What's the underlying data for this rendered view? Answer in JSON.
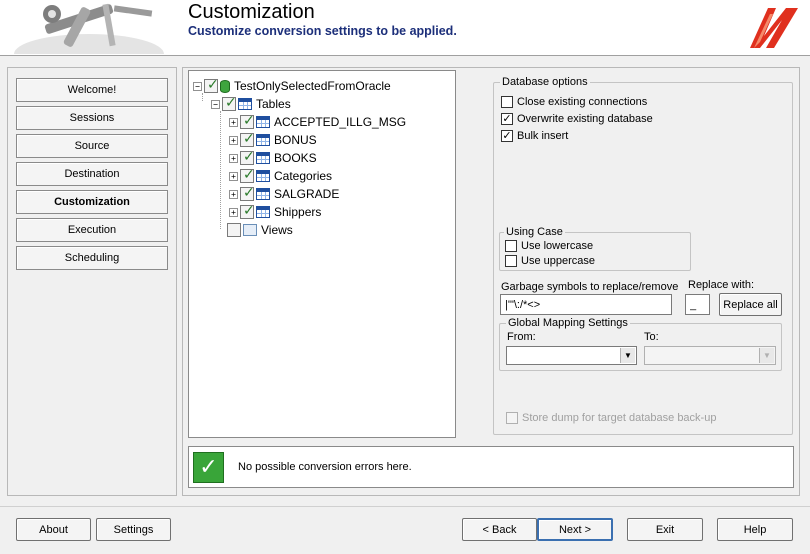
{
  "header": {
    "title": "Customization",
    "subtitle": "Customize conversion settings to be applied."
  },
  "nav": {
    "items": [
      {
        "label": "Welcome!"
      },
      {
        "label": "Sessions"
      },
      {
        "label": "Source"
      },
      {
        "label": "Destination"
      },
      {
        "label": "Customization",
        "active": true
      },
      {
        "label": "Execution"
      },
      {
        "label": "Scheduling"
      }
    ]
  },
  "tree": {
    "root": "TestOnlySelectedFromOracle",
    "tables_label": "Tables",
    "tables": [
      "ACCEPTED_ILLG_MSG",
      "BONUS",
      "BOOKS",
      "Categories",
      "SALGRADE",
      "Shippers"
    ],
    "views_label": "Views"
  },
  "options": {
    "db_group_label": "Database options",
    "close_connections": {
      "label": "Close existing connections",
      "checked": false
    },
    "overwrite_db": {
      "label": "Overwrite existing database",
      "checked": true
    },
    "bulk_insert": {
      "label": "Bulk insert",
      "checked": true
    },
    "case_group_label": "Using Case",
    "lowercase": {
      "label": "Use lowercase",
      "checked": false
    },
    "uppercase": {
      "label": "Use uppercase",
      "checked": false
    },
    "garbage_label": "Garbage symbols to replace/remove",
    "garbage_value": "|'\"\\:/*<>",
    "replace_with_label": "Replace with:",
    "replace_with_value": "_",
    "replace_all_label": "Replace all",
    "mapping_group_label": "Global Mapping Settings",
    "from_label": "From:",
    "to_label": "To:",
    "store_dump": {
      "label": "Store dump for target database back-up",
      "checked": false,
      "disabled": true
    }
  },
  "status": {
    "message": "No possible conversion errors here."
  },
  "footer": {
    "about": "About",
    "settings": "Settings",
    "back": "< Back",
    "next": "Next >",
    "exit": "Exit",
    "help": "Help"
  },
  "colors": {
    "subtitle": "#1c2f7a",
    "status_ok": "#39a539",
    "logo_red": "#e0301e"
  }
}
